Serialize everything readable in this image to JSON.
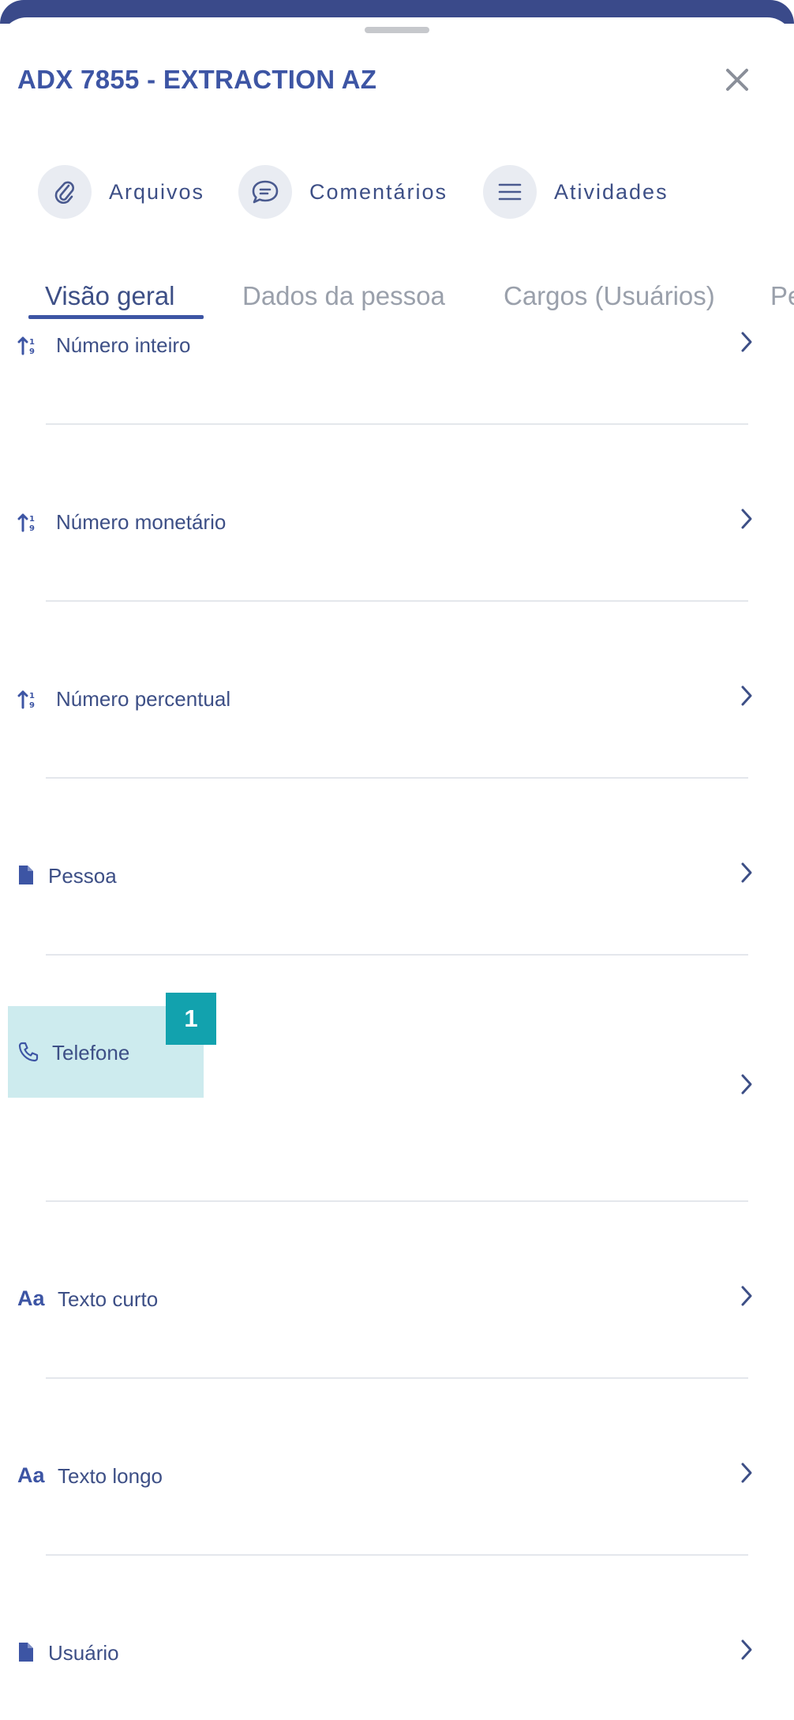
{
  "header": {
    "title": "ADX 7855 - EXTRACTION AZ"
  },
  "actions": [
    {
      "label": "Arquivos",
      "icon": "paperclip-icon"
    },
    {
      "label": "Comentários",
      "icon": "chat-bubble-icon"
    },
    {
      "label": "Atividades",
      "icon": "list-icon"
    }
  ],
  "tabs": [
    {
      "label": "Visão geral",
      "active": true
    },
    {
      "label": "Dados da pessoa",
      "active": false
    },
    {
      "label": "Cargos (Usuários)",
      "active": false
    },
    {
      "label": "Pe",
      "active": false
    }
  ],
  "fields": [
    {
      "label": "Número inteiro",
      "icon": "sort-number-icon"
    },
    {
      "label": "Número monetário",
      "icon": "sort-number-icon"
    },
    {
      "label": "Número percentual",
      "icon": "sort-number-icon"
    },
    {
      "label": "Pessoa",
      "icon": "document-icon"
    },
    {
      "label": "Telefone",
      "icon": "phone-icon"
    },
    {
      "label": "Texto curto",
      "icon": "text-aa-icon"
    },
    {
      "label": "Texto longo",
      "icon": "text-aa-icon"
    },
    {
      "label": "Usuário",
      "icon": "document-icon"
    }
  ],
  "annotation": {
    "badge": "1"
  },
  "colors": {
    "accent": "#3d55a4",
    "header_bar": "#3a4a8a",
    "highlight": "#cdebee",
    "badge": "#12a2ae"
  }
}
